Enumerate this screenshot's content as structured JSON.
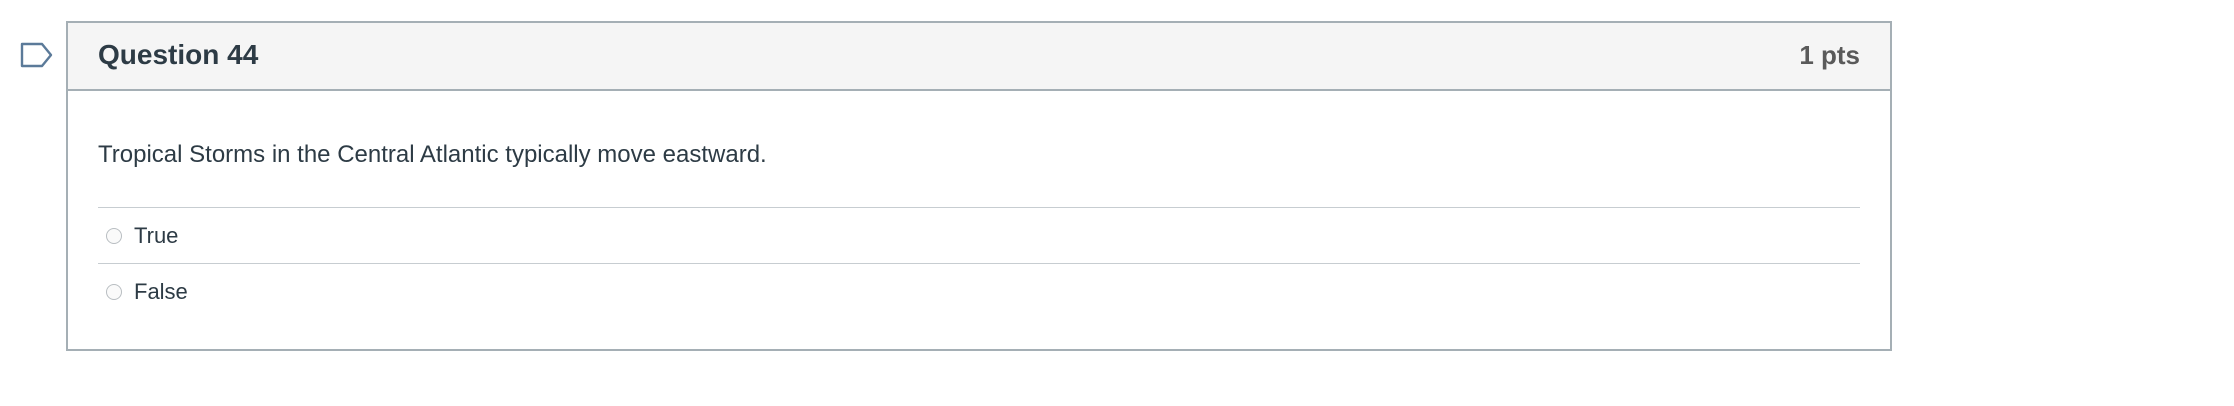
{
  "quiz": {
    "question": {
      "title": "Question 44",
      "points": "1 pts",
      "text": "Tropical Storms in the Central Atlantic typically move eastward.",
      "answers": [
        {
          "label": "True",
          "selected": false
        },
        {
          "label": "False",
          "selected": false
        }
      ]
    },
    "flag_icon": "flag-bookmark-icon",
    "colors": {
      "border": "#a5afb5",
      "header_bg": "#f5f5f5",
      "text": "#2d3b45",
      "points": "#5a5a5a",
      "flag": "#5b7a99"
    }
  }
}
